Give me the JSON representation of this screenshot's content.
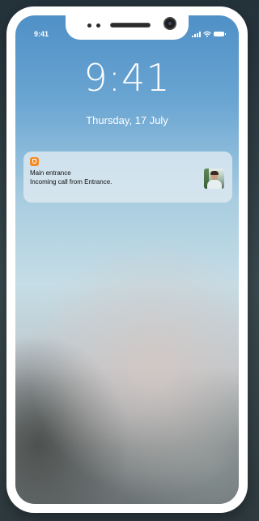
{
  "status_bar": {
    "time": "9:41",
    "signal_icon": "cellular-signal-icon",
    "wifi_icon": "wifi-icon",
    "battery_icon": "battery-icon"
  },
  "lock_screen": {
    "time": "9:41",
    "date": "Thursday, 17 July"
  },
  "notification": {
    "app_icon": "shield-app-icon",
    "app_color": "#f28a28",
    "title": "Main entrance",
    "message": "Incoming call from Entrance.",
    "thumbnail": "caller-photo"
  },
  "colors": {
    "frame": "#ffffff",
    "wallpaper_top": "#4f90c6",
    "wallpaper_bottom": "#6a7173"
  }
}
